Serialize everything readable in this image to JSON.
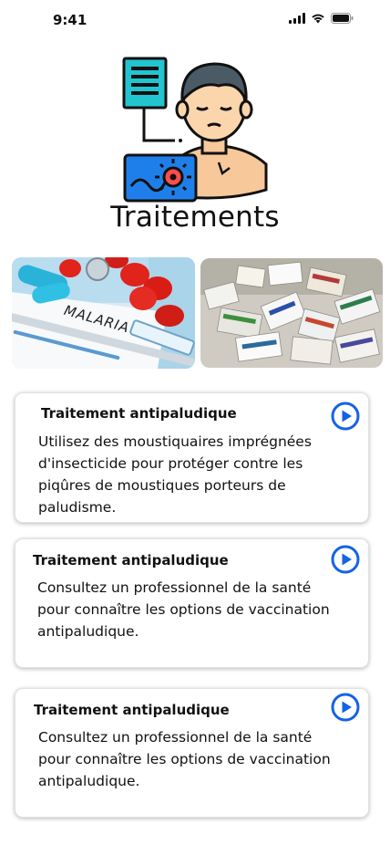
{
  "status_bar": {
    "time": "9:41"
  },
  "header": {
    "title": "Traitements"
  },
  "hero": {
    "icon": "doctor-with-virus-icon"
  },
  "photos": [
    {
      "name": "malaria-photo",
      "label": "MALARIA"
    },
    {
      "name": "medicine-boxes-photo"
    }
  ],
  "cards": [
    {
      "title": "Traitement antipaludique",
      "body": "Utilisez des moustiquaires imprégnées d'insecticide pour protéger contre les piqûres de moustiques porteurs de paludisme.",
      "icon": "play-icon"
    },
    {
      "title": "Traitement antipaludique",
      "body": "Consultez un professionnel de la santé pour connaître les options de vaccination antipaludique.",
      "icon": "play-icon"
    },
    {
      "title": "Traitement antipaludique",
      "body": "Consultez un professionnel de la santé pour connaître les options de vaccination antipaludique.",
      "icon": "play-icon"
    }
  ],
  "colors": {
    "accent": "#1463e6",
    "card_border": "#e2e2e2"
  }
}
